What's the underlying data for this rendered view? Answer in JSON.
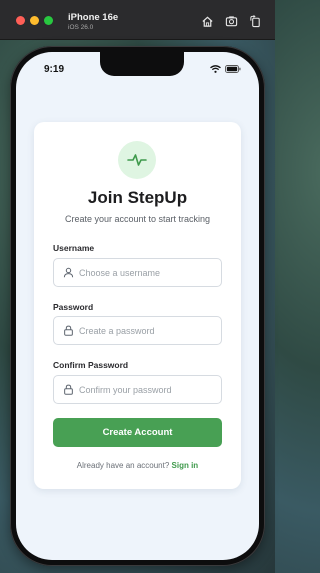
{
  "simulator": {
    "device_name": "iPhone 16e",
    "os_version": "iOS 26.0",
    "toolbar": [
      "home-icon",
      "screenshot-icon",
      "rotate-icon"
    ]
  },
  "status_bar": {
    "time": "9:19",
    "icons": [
      "wifi-icon",
      "battery-icon"
    ]
  },
  "signup": {
    "logo_icon": "activity-pulse-icon",
    "title": "Join StepUp",
    "subtitle": "Create your account to start tracking",
    "fields": [
      {
        "label": "Username",
        "placeholder": "Choose a username",
        "value": "",
        "icon": "user-icon"
      },
      {
        "label": "Password",
        "placeholder": "Create a password",
        "value": "",
        "icon": "lock-icon"
      },
      {
        "label": "Confirm Password",
        "placeholder": "Confirm your password",
        "value": "",
        "icon": "lock-icon"
      }
    ],
    "submit_label": "Create Account",
    "signin_prompt": "Already have an account?",
    "signin_link": "Sign in"
  },
  "colors": {
    "accent": "#48a054",
    "logo_bg": "#dff5e2",
    "screen_bg": "#eef4fb"
  }
}
